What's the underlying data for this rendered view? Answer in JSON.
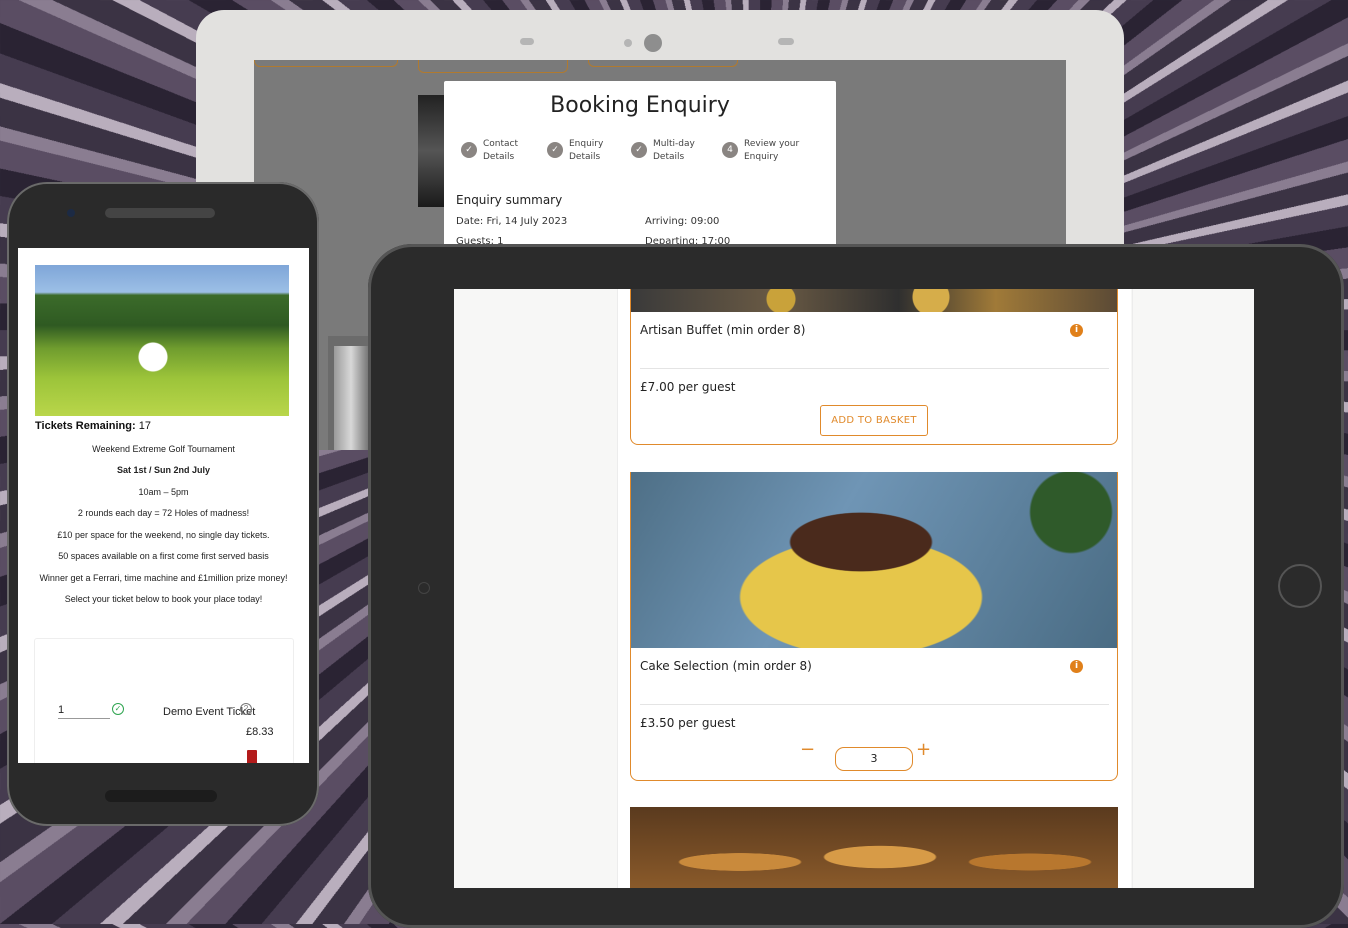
{
  "monitor": {
    "modal": {
      "title": "Booking Enquiry",
      "steps": [
        {
          "icon": "check-icon",
          "label": "Contact\nDetails",
          "marker": "✓"
        },
        {
          "icon": "check-icon",
          "label": "Enquiry\nDetails",
          "marker": "✓"
        },
        {
          "icon": "check-icon",
          "label": "Multi-day\nDetails",
          "marker": "✓"
        },
        {
          "icon": "step-number",
          "label": "Review your\nEnquiry",
          "marker": "4"
        }
      ],
      "summary_title": "Enquiry summary",
      "date": "Date: Fri, 14 July 2023",
      "arriving": "Arriving: 09:00",
      "guests": "Guests: 1",
      "departing": "Departing: 17:00"
    }
  },
  "phone": {
    "tickets_label": "Tickets Remaining:",
    "tickets_value": "17",
    "lines": [
      "Weekend Extreme Golf Tournament",
      "Sat 1st / Sun 2nd July",
      "10am – 5pm",
      "2 rounds each day = 72 Holes of madness!",
      "£10 per space for the weekend, no single day tickets.",
      "50 spaces available on a first come first served basis",
      "Winner get a Ferrari, time machine and £1million prize money!",
      "Select your ticket below to book your place today!"
    ],
    "ticket": {
      "quantity": "1",
      "name": "Demo Event Ticket",
      "price": "£8.33"
    }
  },
  "tablet": {
    "items": [
      {
        "title": "Artisan Buffet (min order 8)",
        "price": "£7.00 per guest",
        "button": "ADD TO BASKET"
      },
      {
        "title": "Cake Selection (min order 8)",
        "price": "£3.50 per guest",
        "quantity": "3",
        "minus": "−",
        "plus": "+"
      }
    ],
    "info_glyph": "i"
  },
  "colors": {
    "accent": "#e08a2c",
    "step_dot": "#8a8582",
    "success": "#2ea44f",
    "danger": "#b31b1b"
  }
}
